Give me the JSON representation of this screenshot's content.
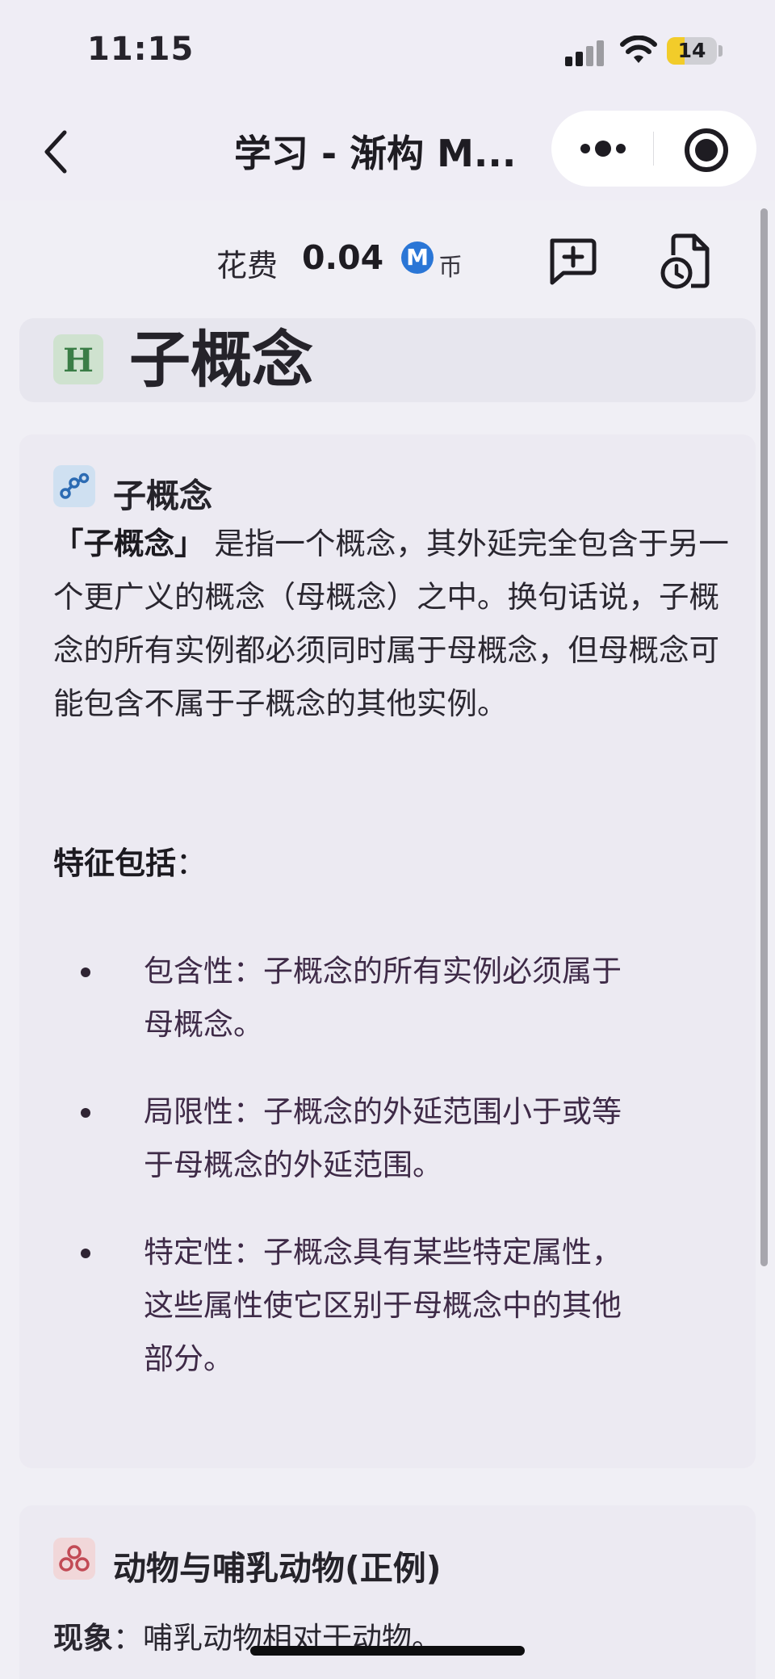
{
  "status_bar": {
    "time": "11:15",
    "battery_level": "14",
    "battery_color": "#f2cc2a",
    "icons": [
      "cellular-signal-icon",
      "wifi-icon",
      "battery-icon"
    ]
  },
  "nav": {
    "title": "学习 - 渐构 M...",
    "back_icon": "chevron-left-icon",
    "more_icon": "more-dots-icon",
    "target_icon": "target-icon"
  },
  "cost": {
    "label": "花费",
    "value": "0.04",
    "coin_symbol": "M",
    "coin_unit": "币",
    "coin_color": "#2a76d6",
    "add_icon": "add-chat-icon",
    "history_icon": "history-icon"
  },
  "page": {
    "badge": "H",
    "title": "子概念"
  },
  "concept_card": {
    "title": "子概念",
    "icon": "network-icon",
    "intro_bold": "「子概念」",
    "intro_text": " 是指一个概念，其外延完全包含于另一个更广义的概念（母概念）之中。换句话说，子概念的所有实例都必须同时属于母概念，但母概念可能包含不属于子概念的其他实例。",
    "features_heading": "特征包括",
    "features_colon": "：",
    "features": [
      "包含性：子概念的所有实例必须属于母概念。",
      "局限性：子概念的外延范围小于或等于母概念的外延范围。",
      "特定性：子概念具有某些特定属性，这些属性使它区别于母概念中的其他部分。"
    ]
  },
  "example_card": {
    "title": "动物与哺乳动物(正例)",
    "icon": "link-circles-icon",
    "phenomenon_label": "现象",
    "phenomenon_text": "：哺乳动物相对于动物。"
  }
}
